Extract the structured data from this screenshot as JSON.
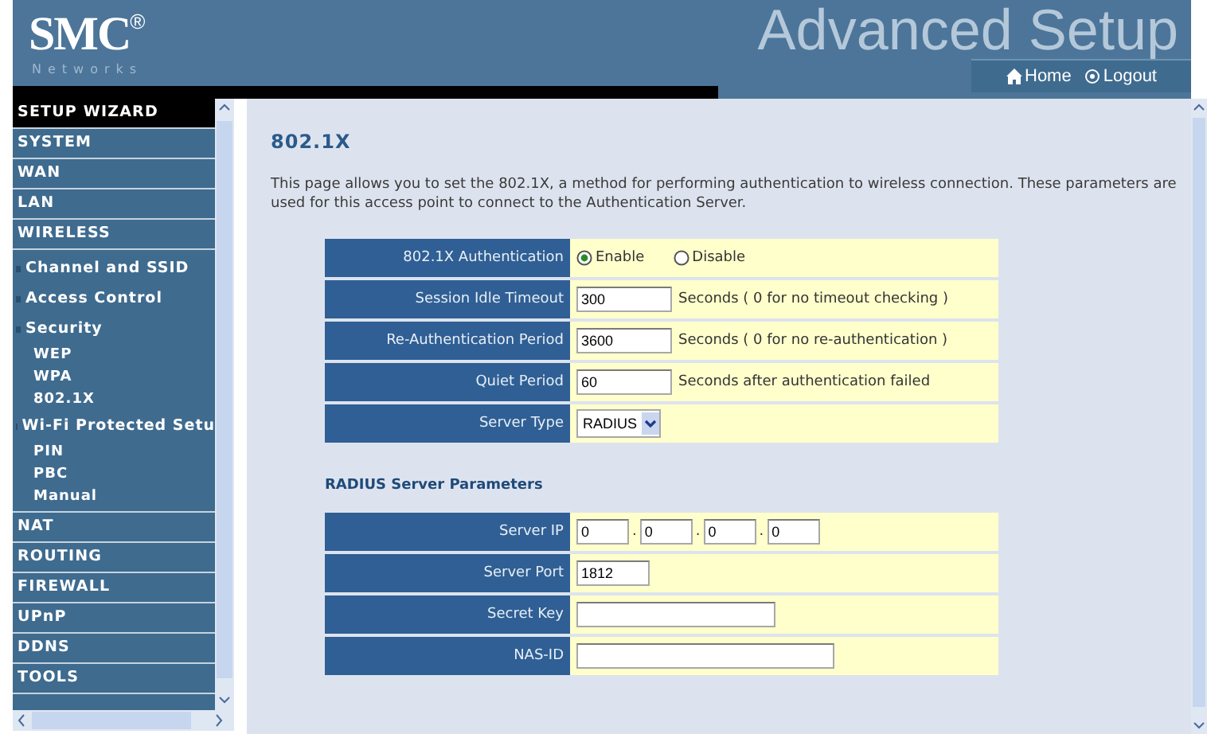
{
  "header": {
    "logo": "SMC",
    "logo_mark": "®",
    "logo_sub": "Networks",
    "banner": "Advanced Setup",
    "links": [
      {
        "kind": "home",
        "label": "Home"
      },
      {
        "kind": "logout",
        "label": "Logout"
      }
    ]
  },
  "sidebar": {
    "items": [
      {
        "label": "SETUP WIZARD",
        "selected": true
      },
      {
        "label": "SYSTEM",
        "selected": false
      },
      {
        "label": "WAN",
        "selected": false
      },
      {
        "label": "LAN",
        "selected": false
      },
      {
        "label": "WIRELESS",
        "selected": false,
        "children": [
          {
            "label": "Channel and SSID",
            "selected": false
          },
          {
            "label": "Access Control",
            "selected": false
          },
          {
            "label": "Security",
            "selected": false,
            "children": [
              {
                "label": "WEP",
                "selected": false
              },
              {
                "label": "WPA",
                "selected": false
              },
              {
                "label": "802.1X",
                "selected": false
              }
            ]
          },
          {
            "label": "Wi-Fi Protected Setu",
            "selected": false,
            "children": [
              {
                "label": "PIN",
                "selected": false
              },
              {
                "label": "PBC",
                "selected": false
              },
              {
                "label": "Manual",
                "selected": false
              }
            ]
          }
        ]
      },
      {
        "label": "NAT",
        "selected": false
      },
      {
        "label": "ROUTING",
        "selected": false
      },
      {
        "label": "FIREWALL",
        "selected": false
      },
      {
        "label": "UPnP",
        "selected": false
      },
      {
        "label": "DDNS",
        "selected": false
      },
      {
        "label": "TOOLS",
        "selected": false
      }
    ]
  },
  "page": {
    "title": "802.1X",
    "description": "This page allows you to set the 802.1X, a method for performing authentication to wireless connection.  These parameters are used for this access point to connect to the Authentication Server.",
    "settings": [
      {
        "kind": "radio",
        "label": "802.1X Authentication",
        "options": [
          {
            "label": "Enable",
            "selected": true
          },
          {
            "label": "Disable",
            "selected": false
          }
        ]
      },
      {
        "kind": "number",
        "label": "Session Idle Timeout",
        "value": "300",
        "note": "Seconds ( 0 for no timeout checking )"
      },
      {
        "kind": "number",
        "label": "Re-Authentication Period",
        "value": "3600",
        "note": "Seconds ( 0 for no re-authentication )"
      },
      {
        "kind": "number",
        "label": "Quiet Period",
        "value": "60",
        "note": "Seconds after authentication failed"
      },
      {
        "kind": "select",
        "label": "Server Type",
        "value": "RADIUS"
      }
    ],
    "radius_heading": "RADIUS Server Parameters",
    "radius": [
      {
        "kind": "ip",
        "label": "Server IP",
        "octets": [
          "0",
          "0",
          "0",
          "0"
        ],
        "separator": "."
      },
      {
        "kind": "port",
        "label": "Server Port",
        "value": "1812"
      },
      {
        "kind": "text",
        "label": "Secret Key"
      },
      {
        "kind": "longtext",
        "label": "NAS-ID"
      }
    ]
  }
}
